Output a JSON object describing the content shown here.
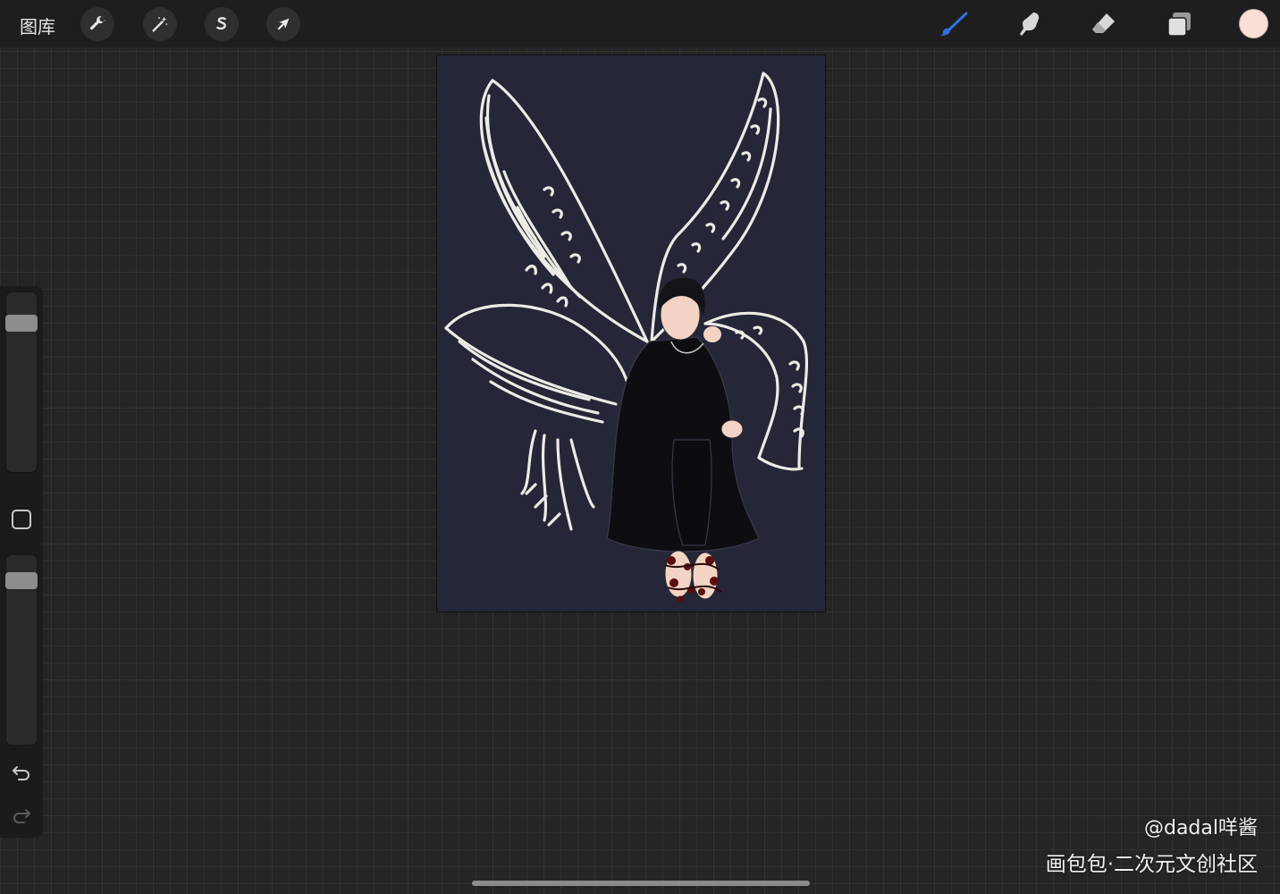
{
  "topbar": {
    "gallery_label": "图库",
    "left_tools": [
      {
        "name": "actions",
        "icon": "wrench-icon"
      },
      {
        "name": "adjustments",
        "icon": "magic-wand-icon"
      },
      {
        "name": "selection",
        "icon": "selection-s-icon"
      },
      {
        "name": "transform",
        "icon": "arrow-cursor-icon"
      }
    ],
    "right_tools": [
      {
        "name": "brush",
        "icon": "brush-icon",
        "active": true
      },
      {
        "name": "smudge",
        "icon": "smudge-finger-icon",
        "active": false
      },
      {
        "name": "eraser",
        "icon": "eraser-icon",
        "active": false
      },
      {
        "name": "layers",
        "icon": "layers-icon",
        "active": false
      }
    ],
    "current_color": "#f9dfd6",
    "active_tool_color": "#2f6fe6"
  },
  "sidebar": {
    "brush_size_level": 0.9,
    "opacity_level": 0.95,
    "modify_button": "square-icon",
    "undo_icon": "undo-icon",
    "redo_icon": "redo-icon"
  },
  "canvas": {
    "background_color": "#252638",
    "artwork": "lineart-winged-figure"
  },
  "watermark": {
    "line1": "@dadal咩酱",
    "line2": "画包包·二次元文创社区"
  }
}
